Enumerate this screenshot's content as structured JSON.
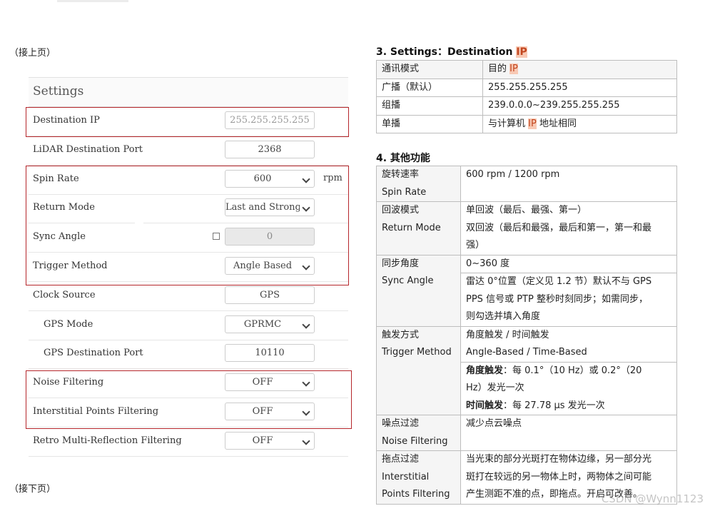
{
  "continued_top": "（接上页）",
  "continued_bottom": "（接下页）",
  "settings": {
    "title": "Settings",
    "rows": [
      {
        "label": "Destination IP",
        "value": "255.255.255.255",
        "kind": "ip"
      },
      {
        "label": "LiDAR Destination Port",
        "value": "2368",
        "kind": "input"
      },
      {
        "label": "Spin Rate",
        "value": "600",
        "kind": "select",
        "unit": "rpm"
      },
      {
        "label": "Return Mode",
        "value": "Last and Strongest",
        "kind": "select"
      },
      {
        "label": "Sync Angle",
        "value": "0",
        "kind": "disabled",
        "checkbox": true
      },
      {
        "label": "Trigger Method",
        "value": "Angle Based",
        "kind": "select"
      },
      {
        "label": "Clock Source",
        "value": "GPS",
        "kind": "input"
      },
      {
        "label": "GPS Mode",
        "value": "GPRMC",
        "kind": "select",
        "indent": true
      },
      {
        "label": "GPS Destination Port",
        "value": "10110",
        "kind": "input",
        "indent": true
      },
      {
        "label": "Noise Filtering",
        "value": "OFF",
        "kind": "select"
      },
      {
        "label": "Interstitial Points Filtering",
        "value": "OFF",
        "kind": "select"
      },
      {
        "label": "Retro Multi-Reflection Filtering",
        "value": "OFF",
        "kind": "select"
      }
    ]
  },
  "section3": {
    "title_prefix": "3. Settings：Destination ",
    "title_hl": "IP",
    "header": {
      "mode": "通讯模式",
      "ip_prefix": "目的 ",
      "ip_hl": "IP"
    },
    "rows": [
      {
        "mode": "广播（默认）",
        "ip": "255.255.255.255"
      },
      {
        "mode": "组播",
        "ip": "239.0.0.0~239.255.255.255"
      }
    ],
    "unicast": {
      "mode": "单播",
      "ip_prefix": "与计算机 ",
      "ip_hl": "IP",
      "ip_suffix": " 地址相同"
    }
  },
  "section4": {
    "title": "4. 其他功能",
    "spin": {
      "zh": "旋转速率",
      "en": "Spin Rate",
      "desc": "600 rpm / 1200 rpm"
    },
    "return": {
      "zh": "回波模式",
      "en": "Return Mode",
      "desc1": "单回波（最后、最强、第一）",
      "desc2": "双回波（最后和最强，最后和第一，第一和最",
      "desc3": "强）"
    },
    "sync": {
      "zh": "同步角度",
      "en": "Sync Angle",
      "desc1": "0~360 度",
      "desc2a": "雷达 0°位置（定义见 1.2 节）默认不与 GPS",
      "desc2b": "PPS 信号或 PTP 整秒时刻同步；如需同步，",
      "desc2c": "则勾选并填入角度"
    },
    "trigger": {
      "zh": "触发方式",
      "en": "Trigger Method",
      "desc1a": "角度触发 / 时间触发",
      "desc1b": "Angle-Based / Time-Based",
      "angle_bold": "角度触发",
      "angle_rest": "：每 0.1°（10 Hz）或 0.2°（20",
      "angle_rest2": "Hz）发光一次",
      "time_bold": "时间触发",
      "time_rest": "：每 27.78 μs 发光一次"
    },
    "noise": {
      "zh": "噪点过滤",
      "en": "Noise Filtering",
      "desc": "减少点云噪点"
    },
    "inter": {
      "zh": "拖点过滤",
      "en1": "Interstitial",
      "en2": "Points Filtering",
      "desc1": "当光束的部分光斑打在物体边缘，另一部分光",
      "desc2": "斑打在较远的另一物体上时，两物体之间可能",
      "desc3": "产生测距不准的点，即拖点。开启可改善。"
    }
  },
  "watermark": "CSDN @Wynn1123"
}
